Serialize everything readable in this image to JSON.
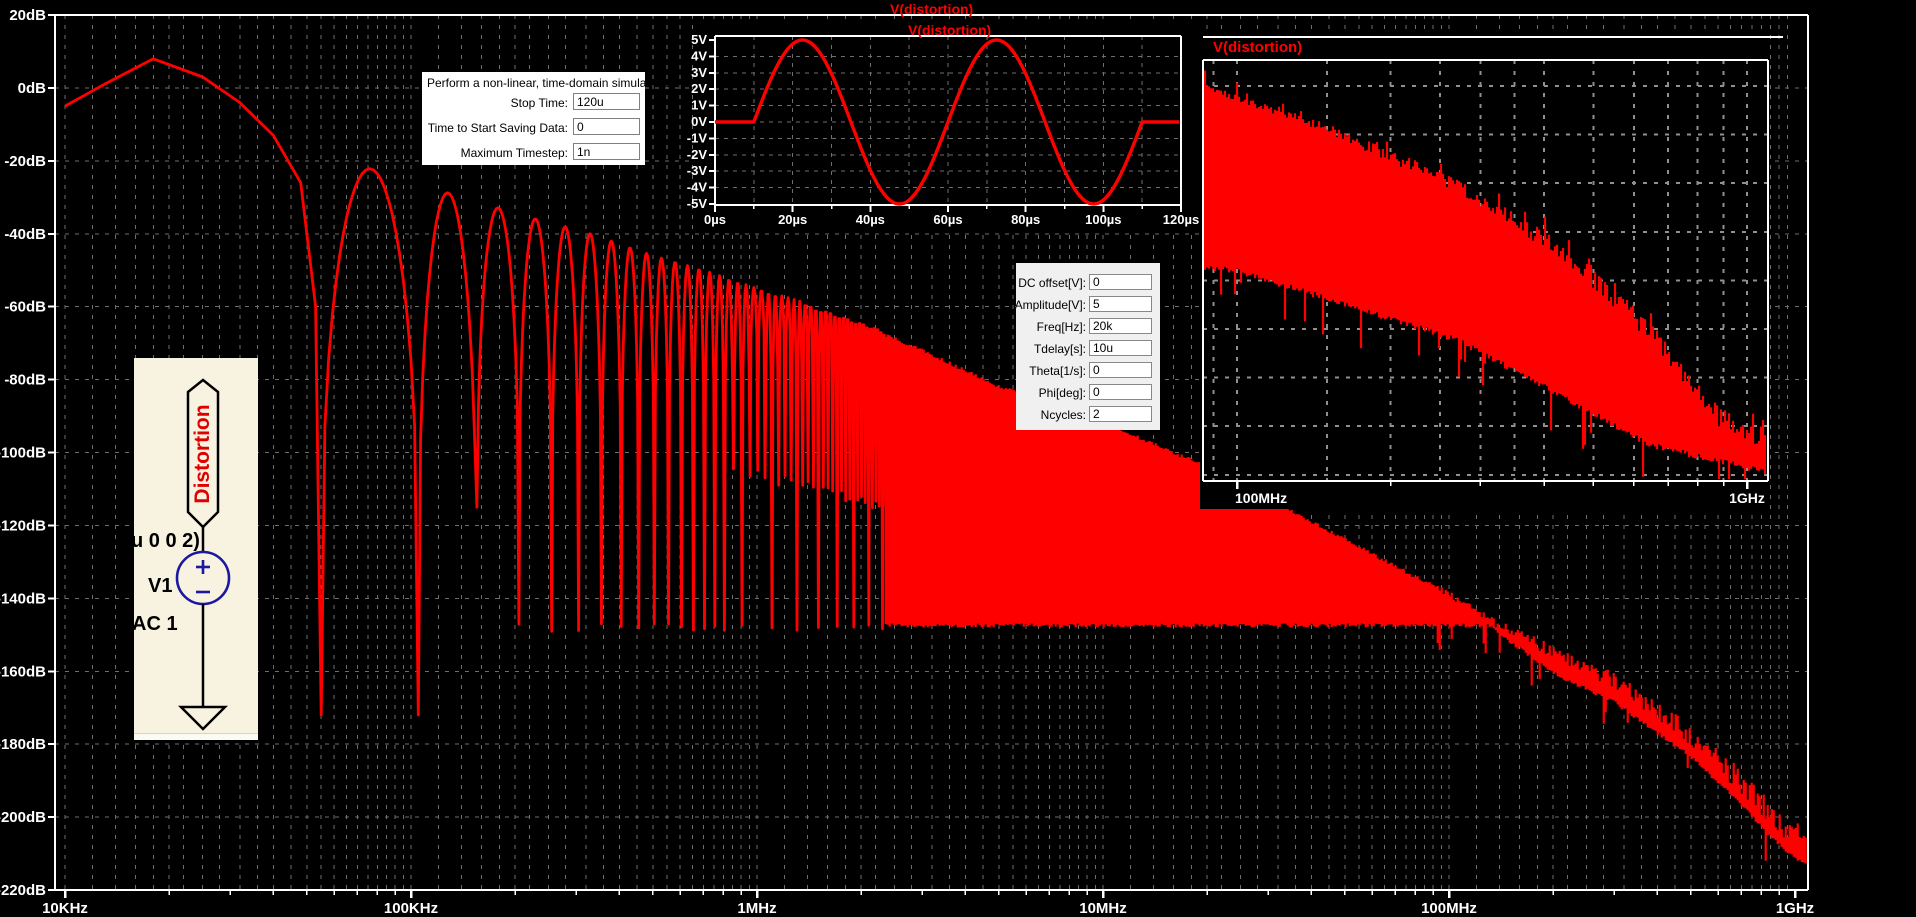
{
  "titles": {
    "main": "V(distortion)",
    "time_inset": "V(distortion)",
    "freq_inset": "V(distortion)"
  },
  "tran_dialog": {
    "title": "Perform a non-linear, time-domain simulation.",
    "rows": [
      {
        "label": "Stop Time:",
        "value": "120u"
      },
      {
        "label": "Time to Start Saving Data:",
        "value": "0"
      },
      {
        "label": "Maximum Timestep:",
        "value": "1n"
      }
    ]
  },
  "sine_params": {
    "rows": [
      {
        "label": "DC offset[V]:",
        "value": "0"
      },
      {
        "label": "Amplitude[V]:",
        "value": "5"
      },
      {
        "label": "Freq[Hz]:",
        "value": "20k"
      },
      {
        "label": "Tdelay[s]:",
        "value": "10u"
      },
      {
        "label": "Theta[1/s]:",
        "value": "0"
      },
      {
        "label": "Phi[deg]:",
        "value": "0"
      },
      {
        "label": "Ncycles:",
        "value": "2"
      }
    ]
  },
  "schematic": {
    "net_label": "Distortion",
    "clipped_text": "u 0 0 2)",
    "designator": "V1",
    "spice_directive": "AC 1"
  },
  "colors": {
    "trace": "#ff0000",
    "grid": "#6e6e6e",
    "inset_grid": "#909090",
    "frame": "#ffffff",
    "bg": "#000000",
    "schematic_bg": "#f8f3e1",
    "symbol_blue": "#1c17a0"
  },
  "chart_data": [
    {
      "type": "line",
      "name": "main-fft",
      "title": "V(distortion)",
      "x_axis": {
        "scale": "log",
        "unit": "Hz",
        "ticks": [
          {
            "label": "10KHz",
            "hz": 10000
          },
          {
            "label": "100KHz",
            "hz": 100000
          },
          {
            "label": "1MHz",
            "hz": 1000000
          },
          {
            "label": "10MHz",
            "hz": 10000000
          },
          {
            "label": "100MHz",
            "hz": 100000000
          },
          {
            "label": "1GHz",
            "hz": 1000000000
          }
        ]
      },
      "y_axis": {
        "unit": "dB",
        "min": -220,
        "max": 20,
        "step": 20,
        "ticks": [
          {
            "label": "20dB",
            "db": 20
          },
          {
            "label": "0dB",
            "db": 0
          },
          {
            "label": "-20dB",
            "db": -20
          },
          {
            "label": "-40dB",
            "db": -40
          },
          {
            "label": "-60dB",
            "db": -60
          },
          {
            "label": "-80dB",
            "db": -80
          },
          {
            "label": "-100dB",
            "db": -100
          },
          {
            "label": "-120dB",
            "db": -120
          },
          {
            "label": "-140dB",
            "db": -140
          },
          {
            "label": "-160dB",
            "db": -160
          },
          {
            "label": "-180dB",
            "db": -180
          },
          {
            "label": "-200dB",
            "db": -200
          },
          {
            "label": "-220dB",
            "db": -220
          }
        ]
      },
      "main_lobe_db": [
        [
          10000,
          -5
        ],
        [
          13000,
          1
        ],
        [
          18000,
          8
        ],
        [
          25000,
          3
        ],
        [
          32000,
          -4
        ],
        [
          40000,
          -13
        ],
        [
          48000,
          -26
        ],
        [
          53000,
          -60
        ]
      ],
      "nulls": {
        "start_hz": 55000,
        "spacing_hz": 50000,
        "end_hz": 2355000,
        "deep_db": -172,
        "floor_db": -148,
        "third_db": -115
      },
      "lobe_peak_env_db": [
        [
          75000,
          -22
        ],
        [
          130000,
          -29
        ],
        [
          180000,
          -33
        ],
        [
          230000,
          -36
        ],
        [
          330000,
          -40
        ],
        [
          500000,
          -46
        ],
        [
          700000,
          -50
        ],
        [
          1000000,
          -55
        ],
        [
          1500000,
          -60
        ],
        [
          2300000,
          -66
        ]
      ],
      "noise_top_db": [
        [
          2400000,
          -68
        ],
        [
          3500000,
          -75
        ],
        [
          5000000,
          -82
        ],
        [
          10000000,
          -92
        ],
        [
          20000000,
          -104
        ],
        [
          50000000,
          -124
        ],
        [
          100000000,
          -139
        ],
        [
          130000000,
          -146
        ],
        [
          200000000,
          -155
        ],
        [
          300000000,
          -163
        ],
        [
          500000000,
          -178
        ],
        [
          700000000,
          -191
        ],
        [
          850000000,
          -200
        ],
        [
          1000000000,
          -206
        ],
        [
          1100000000,
          -207
        ]
      ],
      "noise_bottom_db": [
        [
          2400000,
          -148
        ],
        [
          130000000,
          -148
        ],
        [
          200000000,
          -161
        ],
        [
          300000000,
          -169
        ],
        [
          500000000,
          -184
        ],
        [
          700000000,
          -197
        ],
        [
          850000000,
          -206
        ],
        [
          1000000000,
          -212
        ],
        [
          1100000000,
          -213
        ]
      ]
    },
    {
      "type": "line",
      "name": "time-inset",
      "title": "V(distortion)",
      "signal": {
        "dc_offset_v": 0,
        "amplitude_v": 5,
        "freq_hz": 20000,
        "tdelay_us": 10,
        "ncycles": 2,
        "t_end_us": 120
      },
      "x_ticks": [
        {
          "label": "0µs",
          "us": 0
        },
        {
          "label": "20µs",
          "us": 20
        },
        {
          "label": "40µs",
          "us": 40
        },
        {
          "label": "60µs",
          "us": 60
        },
        {
          "label": "80µs",
          "us": 80
        },
        {
          "label": "100µs",
          "us": 100
        },
        {
          "label": "120µs",
          "us": 120
        }
      ],
      "y_ticks": [
        {
          "label": "5V",
          "v": 5
        },
        {
          "label": "4V",
          "v": 4
        },
        {
          "label": "3V",
          "v": 3
        },
        {
          "label": "2V",
          "v": 2
        },
        {
          "label": "1V",
          "v": 1
        },
        {
          "label": "0V",
          "v": 0
        },
        {
          "label": "-1V",
          "v": -1
        },
        {
          "label": "-2V",
          "v": -2
        },
        {
          "label": "-3V",
          "v": -3
        },
        {
          "label": "-4V",
          "v": -4
        },
        {
          "label": "-5V",
          "v": -5
        }
      ]
    },
    {
      "type": "line",
      "name": "freq-inset",
      "title": "V(distortion)",
      "x_axis": {
        "scale": "log",
        "unit": "Hz",
        "range_hz": [
          86000000,
          1100000000
        ],
        "ticks": [
          {
            "label": "100MHz",
            "hz": 100000000
          },
          {
            "label": "1GHz",
            "hz": 1000000000
          }
        ]
      },
      "band_top_frac": [
        [
          86000000,
          0.064
        ],
        [
          100000000,
          0.09
        ],
        [
          152000000,
          0.166
        ],
        [
          270000000,
          0.297
        ],
        [
          430000000,
          0.451
        ],
        [
          645000000,
          0.641
        ],
        [
          885000000,
          0.855
        ],
        [
          1100000000,
          0.902
        ]
      ],
      "band_bottom_frac": [
        [
          86000000,
          0.494
        ],
        [
          100000000,
          0.5
        ],
        [
          270000000,
          0.665
        ],
        [
          430000000,
          0.796
        ],
        [
          645000000,
          0.915
        ],
        [
          1100000000,
          0.979
        ]
      ]
    }
  ]
}
